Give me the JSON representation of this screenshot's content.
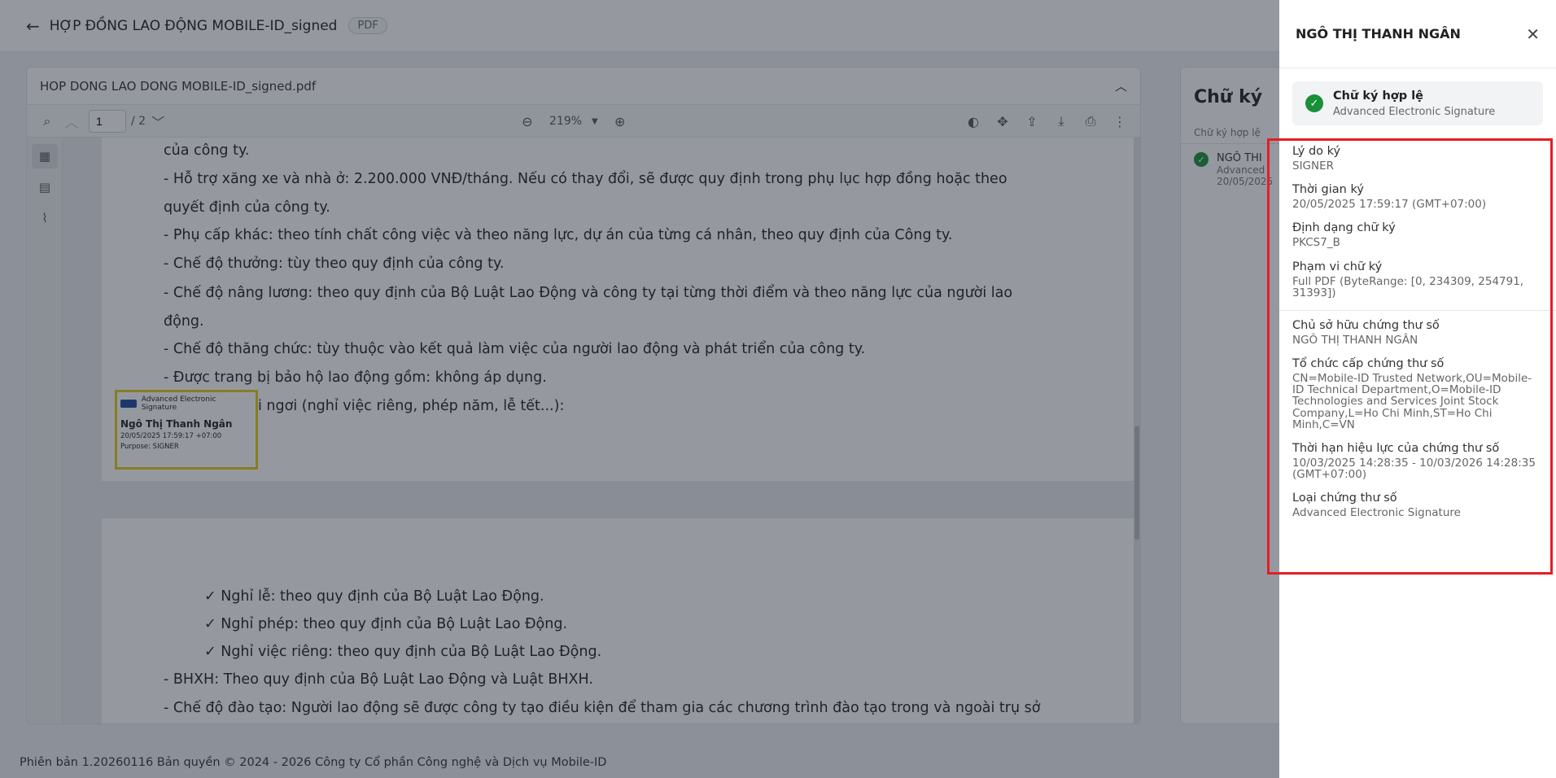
{
  "header": {
    "back_icon": "arrow-left-icon",
    "title": "HỢP ĐỒNG LAO ĐỘNG MOBILE-ID_signed",
    "badge": "PDF"
  },
  "viewer": {
    "file_name": "HOP DONG LAO DONG MOBILE-ID_signed.pdf",
    "page_input": "1",
    "page_total": "/ 2",
    "zoom": "219%",
    "toolbar_icons": [
      "search-icon",
      "chevron-up-icon",
      "chevron-down-icon",
      "zoom-out-icon",
      "zoom-in-icon",
      "color-mode-icon",
      "move-icon",
      "upload-icon",
      "download-icon",
      "print-icon",
      "more-icon"
    ],
    "page1_lines": [
      "của công ty.",
      "- Hỗ trợ xăng xe và nhà ở: 2.200.000 VNĐ/tháng. Nếu có thay đổi, sẽ được quy định trong phụ lục hợp đồng hoặc theo",
      "quyết định của công ty.",
      "- Phụ cấp khác: theo tính chất công việc và theo năng lực, dự án của từng cá nhân, theo quy định của Công ty.",
      "- Chế độ thưởng: tùy theo quy định của công ty.",
      "- Chế độ nâng lương: theo quy định của Bộ Luật Lao Động và công ty tại từng thời điểm và theo năng lực của người lao",
      "động.",
      "- Chế độ thăng chức: tùy thuộc vào kết quả làm việc của người lao động và phát triển của công ty.",
      "- Được trang bị bảo hộ lao động gồm: không áp dụng.",
      "i ngơi (nghỉ việc riêng, phép năm, lễ tết...):"
    ],
    "signature_stamp": {
      "header": "Advanced Electronic Signature",
      "name": "Ngô Thị Thanh Ngân",
      "time": "20/05/2025 17:59:17 +07:00",
      "purpose": "Purpose: SIGNER"
    },
    "page2_lines": [
      "✓ Nghỉ lễ: theo quy định của Bộ Luật Lao Động.",
      "✓ Nghỉ phép: theo quy định của Bộ Luật Lao Động.",
      "✓ Nghỉ việc riêng: theo quy định của Bộ Luật Lao Động.",
      "- BHXH: Theo quy định của Bộ Luật Lao Động và Luật BHXH.",
      "- Chế độ đào tạo: Người lao động sẽ được công ty tạo điều kiện để tham gia các chương trình đào tạo trong và ngoài trụ sở"
    ]
  },
  "signatures_panel": {
    "title": "Chữ ký",
    "section": "Chữ ký hợp lệ",
    "item_name": "NGÔ THI",
    "item_sub": "Advanced",
    "item_date": "20/05/2025"
  },
  "footer": {
    "text": "Phiên bản 1.20260116 Bản quyền © 2024 - 2026 Công ty Cổ phần Công nghệ và Dịch vụ Mobile-ID"
  },
  "detail_panel": {
    "title": "NGÔ THỊ THANH NGÂN",
    "status_title": "Chữ ký hợp lệ",
    "status_sub": "Advanced Electronic Signature",
    "fields": [
      {
        "label": "Lý do ký",
        "value": "SIGNER"
      },
      {
        "label": "Thời gian ký",
        "value": "20/05/2025 17:59:17 (GMT+07:00)"
      },
      {
        "label": "Định dạng chữ ký",
        "value": "PKCS7_B"
      },
      {
        "label": "Phạm vi chữ ký",
        "value": "Full PDF (ByteRange: [0, 234309, 254791, 31393])"
      }
    ],
    "cert_fields": [
      {
        "label": "Chủ sở hữu chứng thư số",
        "value": "NGÔ THỊ THANH NGÂN"
      },
      {
        "label": "Tổ chức cấp chứng thư số",
        "value": "CN=Mobile-ID Trusted Network,OU=Mobile-ID Technical Department,O=Mobile-ID Technologies and Services Joint Stock Company,L=Ho Chi Minh,ST=Ho Chi Minh,C=VN"
      },
      {
        "label": "Thời hạn hiệu lực của chứng thư số",
        "value": "10/03/2025 14:28:35 - 10/03/2026 14:28:35 (GMT+07:00)"
      },
      {
        "label": "Loại chứng thư số",
        "value": "Advanced Electronic Signature"
      }
    ]
  }
}
